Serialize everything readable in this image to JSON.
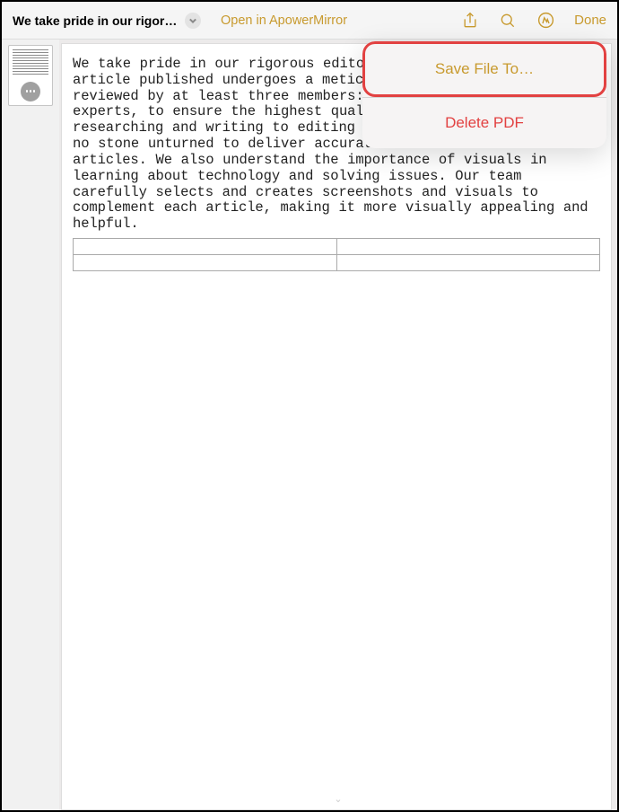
{
  "toolbar": {
    "title": "We take pride in our rigorous edito…",
    "open_in_label": "Open in ApowerMirror",
    "done_label": "Done"
  },
  "popover": {
    "save_label": "Save File To…",
    "delete_label": "Delete PDF"
  },
  "document": {
    "body": "We take pride in our rigorous editorial guidelines. Every article published undergoes a meticulous review process, reviewed by at least three members: editors, and visual experts, to ensure the highest quality of content. From researching and writing to editing and fact-checking, we leave no stone unturned to deliver accurate and well-crafted articles. We also understand the importance of visuals in learning about technology and solving issues. Our team carefully selects and creates screenshots and visuals to complement each article, making it more visually appealing and helpful."
  },
  "icons": {
    "share": "share-icon",
    "search": "search-icon",
    "markup": "markup-icon",
    "chevron": "chevron-down-icon",
    "more": "more-icon"
  }
}
